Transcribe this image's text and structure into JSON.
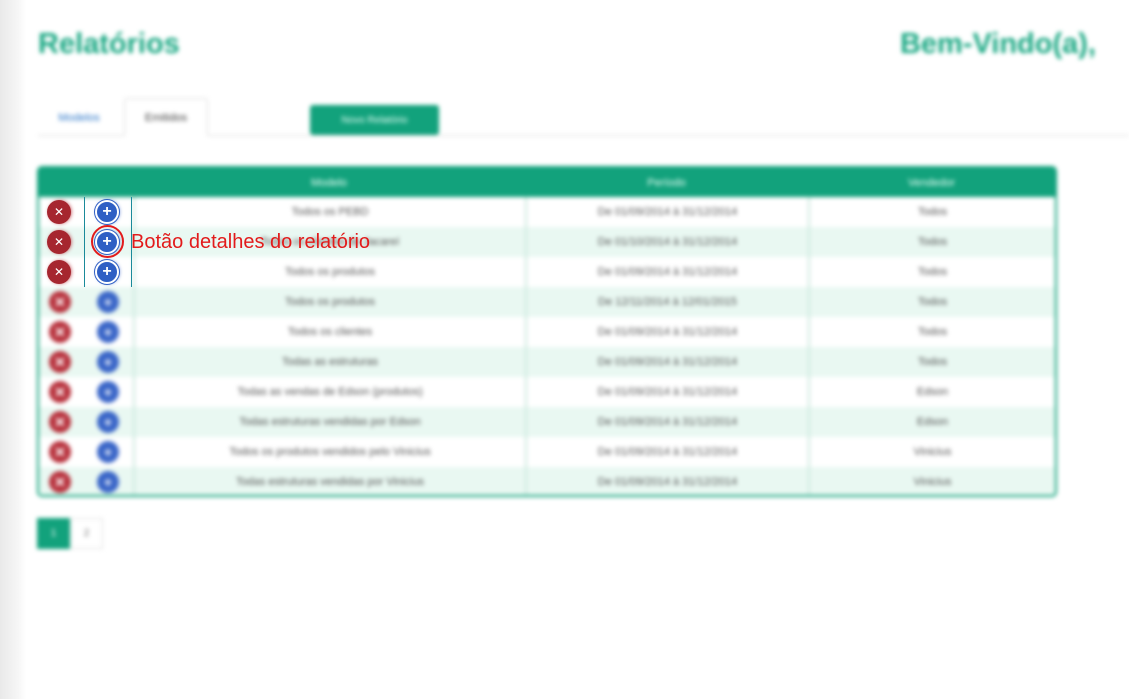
{
  "page": {
    "title": "Relatórios",
    "welcome": "Bem-Vindo(a),"
  },
  "tabs": [
    {
      "label": "Modelos"
    },
    {
      "label": "Emitidos"
    }
  ],
  "new_report_button": {
    "label": "Novo Relatório"
  },
  "table": {
    "headers": [
      "Modelo",
      "Período",
      "Vendedor"
    ],
    "rows": [
      {
        "model": "Todos os PEBD",
        "period": "De 01/09/2014 à 31/12/2014",
        "vendor": "Todos"
      },
      {
        "model": "Todos os clientes de Jacareí",
        "period": "De 01/10/2014 à 31/12/2014",
        "vendor": "Todos"
      },
      {
        "model": "Todos os produtos",
        "period": "De 01/09/2014 à 31/12/2014",
        "vendor": "Todos"
      },
      {
        "model": "Todos os produtos",
        "period": "De 12/11/2014 à 12/01/2015",
        "vendor": "Todos"
      },
      {
        "model": "Todos os clientes",
        "period": "De 01/09/2014 à 31/12/2014",
        "vendor": "Todos"
      },
      {
        "model": "Todas as estruturas",
        "period": "De 01/09/2014 à 31/12/2014",
        "vendor": "Todos"
      },
      {
        "model": "Todas as vendas de Edson (produtos)",
        "period": "De 01/09/2014 à 31/12/2014",
        "vendor": "Edson"
      },
      {
        "model": "Todas estruturas vendidas por Edson",
        "period": "De 01/09/2014 à 31/12/2014",
        "vendor": "Edson"
      },
      {
        "model": "Todos os produtos vendidos pelo Vinicius",
        "period": "De 01/09/2014 à 31/12/2014",
        "vendor": "Vinicius"
      },
      {
        "model": "Todas estruturas vendidas por Vinicius",
        "period": "De 01/09/2014 à 31/12/2014",
        "vendor": "Vinicius"
      }
    ]
  },
  "pagination": {
    "pages": [
      "1",
      "2"
    ],
    "active": "1"
  },
  "annotation": {
    "text": "Botão detalhes do relatório"
  },
  "icons": {
    "delete": "delete-circle-icon",
    "details": "plus-circle-icon"
  },
  "colors": {
    "accent": "#12a27c",
    "title": "#1aa883",
    "delete": "#b8323d",
    "details": "#3a66c8",
    "annotation": "#e21b1b"
  }
}
